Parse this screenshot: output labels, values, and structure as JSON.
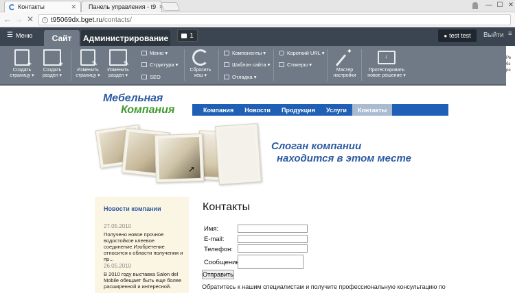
{
  "browser": {
    "tabs": [
      {
        "title": "Контакты"
      },
      {
        "title": "Панель управления - t9"
      }
    ],
    "url_host": "t95069dx.bget.ru",
    "url_path": "/contacts/",
    "win": {
      "min": "—",
      "max": "☐",
      "close": "✕"
    }
  },
  "panel": {
    "menu_label": "Меню",
    "tab_site": "Сайт",
    "tab_admin": "Администрирование",
    "notif_count": "1",
    "user": "test test",
    "logout": "Выйти",
    "tools_big": [
      {
        "line1": "Создать",
        "line2": "страницу ▾"
      },
      {
        "line1": "Создать",
        "line2": "раздел ▾"
      },
      {
        "line1": "Изменить",
        "line2": "страницу ▾"
      },
      {
        "line1": "Изменить",
        "line2": "раздел ▾"
      }
    ],
    "tools_small_a": [
      "Меню ▾",
      "Структура ▾",
      "SEO"
    ],
    "reset_cache": {
      "line1": "Сбросить",
      "line2": "кеш ▾"
    },
    "tools_small_b": [
      "Компоненты ▾",
      "Шаблон сайта ▾",
      "Отладка ▾"
    ],
    "tools_small_c": [
      "Короткий URL ▾",
      "Стикеры ▾"
    ],
    "wizard": {
      "line1": "Мастер",
      "line2": "настройки"
    },
    "test_solution": {
      "line1": "Протестировать",
      "line2": "новое решение ▾"
    },
    "right_edge": [
      "Ре",
      "бэ",
      "ре"
    ]
  },
  "site": {
    "logo_line1": "Мебельная",
    "logo_line2": "Компания",
    "nav": [
      "Компания",
      "Новости",
      "Продукция",
      "Услуги",
      "Контакты"
    ],
    "slogan1": "Слоган компании",
    "slogan2": "находится в этом месте",
    "news_title": "Новости компании",
    "news": [
      {
        "date": "27.05.2010",
        "text": "Получено новое прочное водостойкое клеевое соединение.Изобретение относится к области получения и пр..."
      },
      {
        "date": "26.05.2010",
        "text": "В 2010 году выставка Salon del Mobile обещает быть еще более расширенной и интересной."
      }
    ],
    "contacts_title": "Контакты",
    "form": {
      "name_label": "Имя:",
      "email_label": "E-mail:",
      "phone_label": "Телефон:",
      "message_label": "Сообщение:",
      "submit": "Отправить"
    },
    "footer_text": "Обратитесь к нашим специалистам и получите профессиональную консультацию по"
  }
}
